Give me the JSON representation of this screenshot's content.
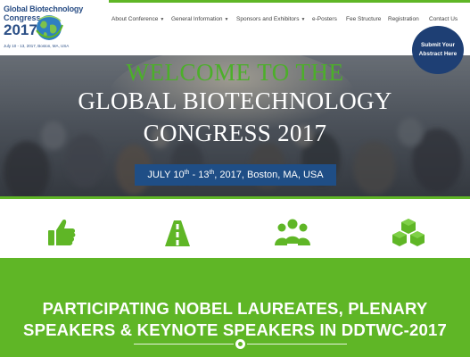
{
  "logo": {
    "line1": "Global Biotechnology",
    "line2": "Congress",
    "year": "2017",
    "subtitle": "July 10 - 13, 2017, Boston, MA, USA"
  },
  "nav": {
    "items": [
      {
        "label": "About Conference",
        "has_dropdown": true
      },
      {
        "label": "General Information",
        "has_dropdown": true
      },
      {
        "label": "Sponsors and Exhibitors",
        "has_dropdown": true
      },
      {
        "label": "e-Posters",
        "has_dropdown": false
      },
      {
        "label": "Fee Structure",
        "has_dropdown": false
      },
      {
        "label": "Registration",
        "has_dropdown": false
      },
      {
        "label": "Contact Us",
        "has_dropdown": false
      }
    ]
  },
  "submit_button": {
    "line1": "Submit Your",
    "line2": "Abstract Here"
  },
  "hero": {
    "welcome": "WELCOME TO THE",
    "title_line1": "GLOBAL BIOTECHNOLOGY",
    "title_line2": "CONGRESS 2017",
    "date": {
      "part1": "JULY 10",
      "sup1": "th",
      "part2": " - 13",
      "sup2": "th",
      "part3": ", 2017, Boston, MA, USA"
    }
  },
  "features": [
    {
      "icon": "thumbs-up-icon"
    },
    {
      "icon": "road-icon"
    },
    {
      "icon": "users-icon"
    },
    {
      "icon": "cubes-icon"
    }
  ],
  "speakers": {
    "line1": "PARTICIPATING NOBEL LAUREATES, PLENARY",
    "line2": "SPEAKERS & KEYNOTE SPEAKERS IN DDTWC-2017"
  },
  "colors": {
    "green": "#5fb626",
    "navy": "#1e3f74",
    "date_pill": "#1f4e86",
    "welcome_green": "#4caf2a"
  }
}
